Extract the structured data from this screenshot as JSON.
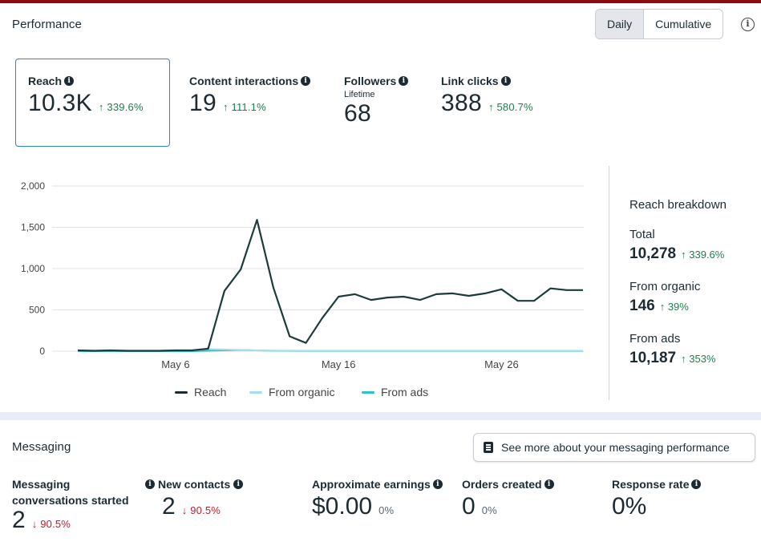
{
  "performance": {
    "title": "Performance",
    "toggle": {
      "daily": "Daily",
      "cumulative": "Cumulative",
      "selected": "Daily"
    },
    "metrics": [
      {
        "label": "Reach",
        "value": "10.3K",
        "delta": "339.6%",
        "direction": "up",
        "selected": true
      },
      {
        "label": "Content interactions",
        "value": "19",
        "delta": "111.1%",
        "direction": "up"
      },
      {
        "label": "Followers",
        "sublabel": "Lifetime",
        "value": "68"
      },
      {
        "label": "Link clicks",
        "value": "388",
        "delta": "580.7%",
        "direction": "up"
      }
    ]
  },
  "chart_data": {
    "type": "line",
    "yticks": [
      "2,000",
      "1,500",
      "1,000",
      "500",
      "0"
    ],
    "ylim": [
      0,
      2000
    ],
    "xticks": [
      "May 6",
      "May 16",
      "May 26"
    ],
    "x": [
      "Apr 30",
      "May 1",
      "May 2",
      "May 3",
      "May 4",
      "May 5",
      "May 6",
      "May 7",
      "May 8",
      "May 9",
      "May 10",
      "May 11",
      "May 12",
      "May 13",
      "May 14",
      "May 15",
      "May 16",
      "May 17",
      "May 18",
      "May 19",
      "May 20",
      "May 21",
      "May 22",
      "May 23",
      "May 24",
      "May 25",
      "May 26",
      "May 27",
      "May 28",
      "May 29",
      "May 30",
      "May 31"
    ],
    "series": [
      {
        "name": "Reach",
        "color": "#1d3b3b",
        "values": [
          10,
          5,
          10,
          5,
          5,
          5,
          10,
          10,
          30,
          730,
          990,
          1590,
          770,
          180,
          100,
          400,
          660,
          690,
          620,
          650,
          660,
          620,
          690,
          700,
          670,
          700,
          750,
          610,
          610,
          760,
          740,
          740
        ]
      },
      {
        "name": "From organic",
        "color": "#a7dcf2",
        "values": [
          10,
          5,
          10,
          5,
          5,
          5,
          10,
          10,
          25,
          20,
          15,
          10,
          8,
          6,
          5,
          5,
          5,
          5,
          5,
          5,
          5,
          5,
          5,
          5,
          5,
          5,
          5,
          5,
          5,
          5,
          5,
          5
        ]
      },
      {
        "name": "From ads",
        "color": "#2fbfc9",
        "values": [
          0,
          0,
          0,
          0,
          0,
          0,
          0,
          0,
          5,
          10,
          15,
          10,
          5,
          4,
          3,
          2,
          2,
          2,
          2,
          2,
          2,
          2,
          2,
          2,
          2,
          2,
          2,
          2,
          2,
          2,
          2,
          2
        ]
      }
    ],
    "grid": true,
    "legend": "bottom"
  },
  "breakdown": {
    "title": "Reach breakdown",
    "items": [
      {
        "label": "Total",
        "value": "10,278",
        "delta": "339.6%"
      },
      {
        "label": "From organic",
        "value": "146",
        "delta": "39%"
      },
      {
        "label": "From ads",
        "value": "10,187",
        "delta": "353%"
      }
    ]
  },
  "messaging": {
    "title": "Messaging",
    "see_more": "See more about your messaging performance",
    "metrics": [
      {
        "label": "Messaging conversations started",
        "value": "2",
        "delta": "90.5%",
        "direction": "down"
      },
      {
        "label": "New contacts",
        "value": "2",
        "delta": "90.5%",
        "direction": "down"
      },
      {
        "label": "Approximate earnings",
        "value": "$0.00",
        "delta": "0%"
      },
      {
        "label": "Orders created",
        "value": "0",
        "delta": "0%"
      },
      {
        "label": "Response rate",
        "value": "0%"
      }
    ]
  }
}
